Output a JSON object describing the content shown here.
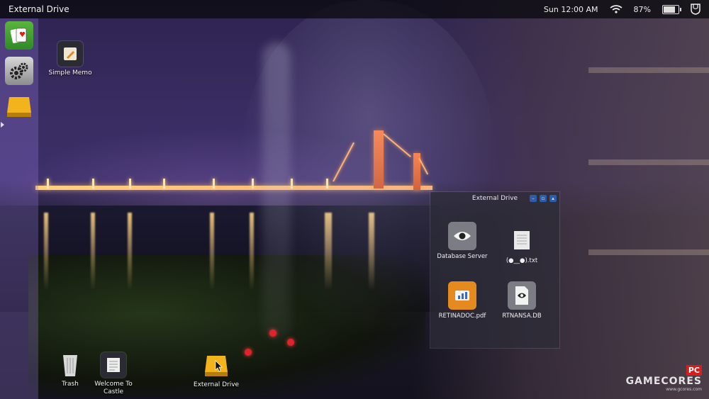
{
  "topbar": {
    "title": "External Drive",
    "datetime": "Sun 12:00 AM",
    "battery": "87%",
    "battery_level": 0.87,
    "icons": [
      "wifi-icon",
      "battery-icon",
      "shield-icon"
    ]
  },
  "dock": {
    "items": [
      {
        "name": "solitaire-cards-icon"
      },
      {
        "name": "settings-gears-icon"
      },
      {
        "name": "external-drive-icon"
      }
    ]
  },
  "desktop": {
    "icons": [
      {
        "label": "Simple Memo",
        "icon": "memo-icon"
      },
      {
        "label": "Trash",
        "icon": "trash-icon"
      },
      {
        "label": "Welcome To Castle",
        "icon": "document-icon"
      },
      {
        "label": "External Drive",
        "icon": "external-drive-icon"
      }
    ]
  },
  "window": {
    "title": "External Drive",
    "files": [
      {
        "label": "Database Server",
        "icon": "eye-icon"
      },
      {
        "label": "(●__●).txt",
        "icon": "text-file-icon"
      },
      {
        "label": "RETINADOC.pdf",
        "icon": "chart-doc-icon"
      },
      {
        "label": "RTNANSA.DB",
        "icon": "eye-file-icon"
      }
    ]
  },
  "watermark": {
    "badge": "PC",
    "brand": "GAMECORES",
    "url": "www.gcores.com"
  },
  "colors": {
    "dock_bg": "#9678dc",
    "window_bg": "#2d2d37",
    "accent_orange": "#e58a1e",
    "topbar_bg": "#0a0a0e"
  }
}
